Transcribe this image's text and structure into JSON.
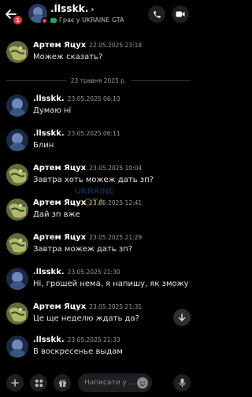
{
  "header": {
    "notif_count": "1",
    "name": ".llsskk.",
    "status_line": "Грає у UKRAINE GTA",
    "colors": {
      "dnd": "#f23f43",
      "badge": "#e03b3b",
      "game": "#23a55a"
    }
  },
  "messages": [
    {
      "author": "Артем Яцух",
      "time": "22.05.2025 23:18",
      "text": "Можеж сказать?",
      "avatar": "map"
    },
    {
      "author": ".llsskk.",
      "time": "23.05.2025 06:10",
      "text": "Думаю ні",
      "avatar": "dark"
    },
    {
      "author": ".llsskk.",
      "time": "23.05.2025 06:11",
      "text": "Блин",
      "avatar": "dark"
    },
    {
      "author": "Артем Яцух",
      "time": "23.05.2025 10:04",
      "text": "Завтра хоть можеж дать зп?",
      "avatar": "map"
    },
    {
      "author": "Артем Яцух",
      "time": "23.05.2025 12:41",
      "text": "Дай зп вже",
      "avatar": "map"
    },
    {
      "author": "Артем Яцух",
      "time": "23.05.2025 21:29",
      "text": "Завтра можеж дать зп?",
      "avatar": "map"
    },
    {
      "author": ".llsskk.",
      "time": "23.05.2025 21:30",
      "text": "Ні, грошей нема, я напишу, як зможу",
      "avatar": "dark"
    },
    {
      "author": "Артем Яцух",
      "time": "23.05.2025 21:31",
      "text": "Це ще неделю ждать да?",
      "avatar": "map"
    },
    {
      "author": ".llsskk.",
      "time": "23.05.2025 21:33",
      "text": "В воскресенье выдам",
      "avatar": "dark"
    }
  ],
  "date_divider": "23 травня 2025 р.",
  "watermark": "UKRAINE GTA",
  "composer": {
    "placeholder": "Написати у ..."
  }
}
